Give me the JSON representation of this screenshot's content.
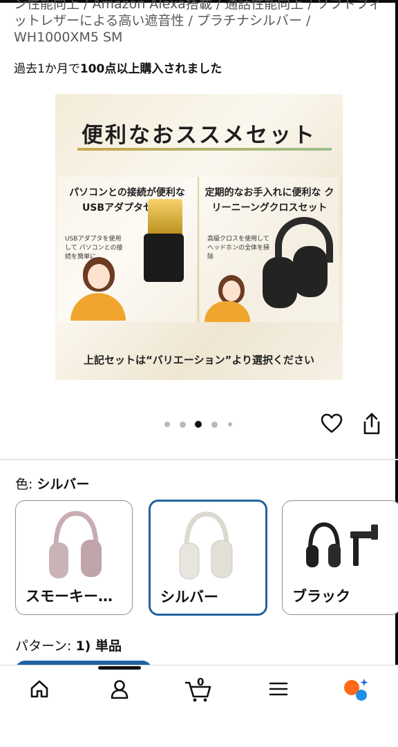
{
  "product": {
    "title": "ン性能向上 / Amazon Alexa搭載 / 通話性能向上 / ソフトフィットレザーによる高い遮音性 / プラチナシルバー / WH1000XM5 SM",
    "purchase_prefix": "過去1か月で",
    "purchase_bold": "100点以上購入されました"
  },
  "hero_image": {
    "title": "便利なおススメセット",
    "left_panel": {
      "head": "パソコンとの接続が便利な USBアダプタセット",
      "note": "USBアダプタを使用して パソコンとの接続を簡単に"
    },
    "right_panel": {
      "head": "定期的なお手入れに便利な クリーニーングクロスセット",
      "note": "高級クロスを使用して ヘッドホンの全体を掃除"
    },
    "footer": "上記セットは“バリエーション”より選択ください"
  },
  "carousel": {
    "total": 5,
    "active_index": 2
  },
  "actions": {
    "wishlist_icon": "heart-icon",
    "share_icon": "share-icon"
  },
  "color": {
    "label": "色:",
    "selected": "シルバー",
    "options": [
      {
        "label": "スモーキー…",
        "swatch": "#c9b3b6"
      },
      {
        "label": "シルバー",
        "swatch": "#e7e5de"
      },
      {
        "label": "ブラック",
        "swatch": "#1f1f1f"
      }
    ]
  },
  "pattern": {
    "label": "パターン:",
    "selected": "1) 単品"
  },
  "bottom_nav": {
    "items": [
      "home-icon",
      "account-icon",
      "cart-icon",
      "menu-icon",
      "alexa-icon"
    ],
    "cart_count": "0"
  },
  "colors": {
    "accent": "#2162a1",
    "text": "#0f1111",
    "muted": "#565959"
  }
}
